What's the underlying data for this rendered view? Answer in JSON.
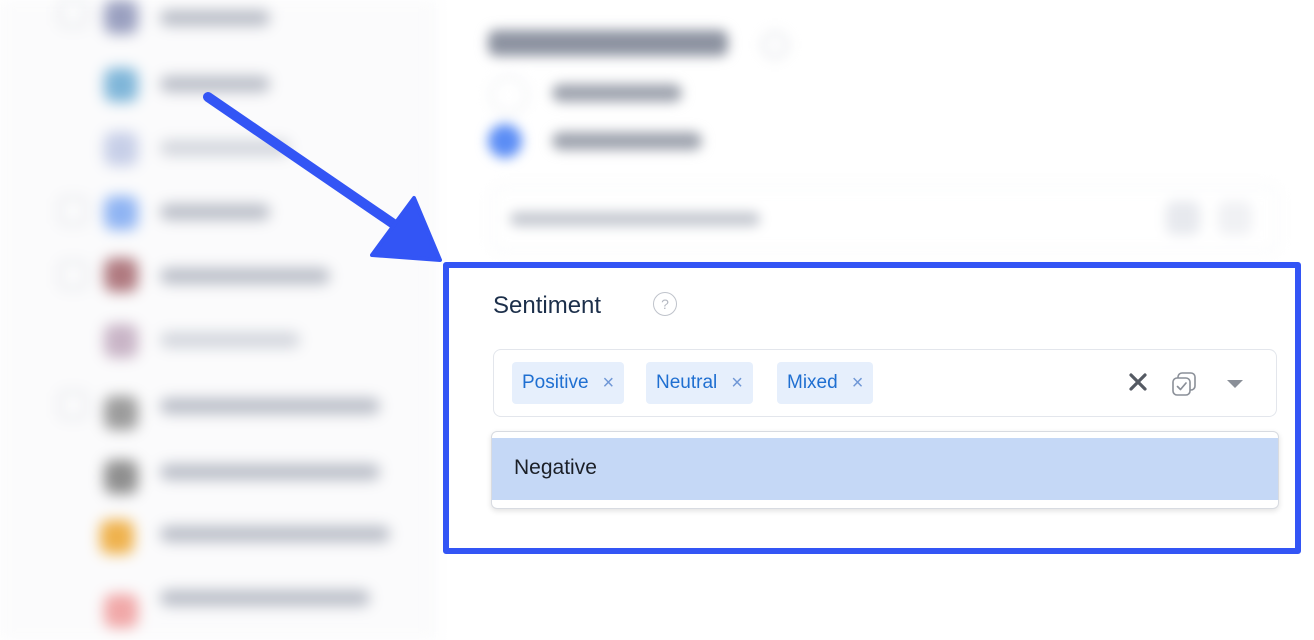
{
  "field": {
    "label": "Sentiment",
    "help_symbol": "?"
  },
  "multiselect": {
    "selected_chips": [
      {
        "label": "Positive"
      },
      {
        "label": "Neutral"
      },
      {
        "label": "Mixed"
      }
    ],
    "chip_remove_symbol": "×"
  },
  "dropdown": {
    "options": [
      {
        "label": "Negative",
        "highlighted": true
      }
    ]
  },
  "colors": {
    "highlight_border": "#3355f5",
    "arrow": "#3355f5",
    "chip_background": "#e6effc",
    "chip_text": "#1f6fd1",
    "option_hover": "#c5d8f6"
  }
}
